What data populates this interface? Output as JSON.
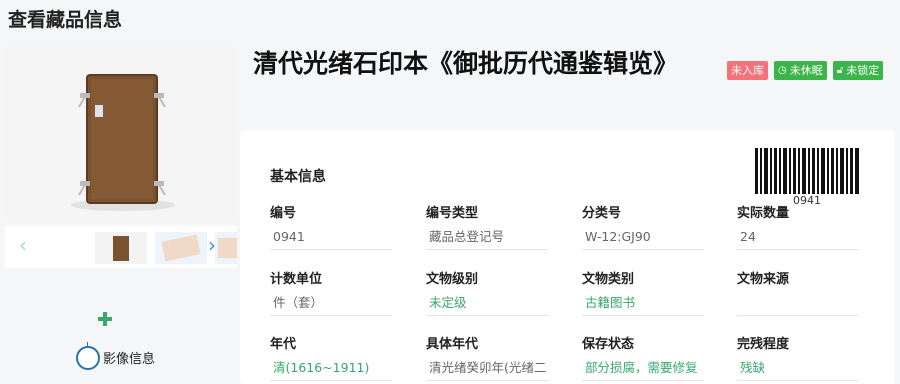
{
  "page_title": "查看藏品信息",
  "item": {
    "title": "清代光绪石印本《御批历代通鉴辑览》",
    "badges": [
      {
        "label": "未入库",
        "color": "#f2737c",
        "icon": ""
      },
      {
        "label": "未休眠",
        "color": "#3bb54a",
        "icon": "clock-icon"
      },
      {
        "label": "未锁定",
        "color": "#3bb54a",
        "icon": "lock-icon"
      }
    ]
  },
  "media": {
    "section_label": "影像信息"
  },
  "barcode": {
    "number": "0941"
  },
  "basic_info": {
    "section_title": "基本信息",
    "fields": [
      {
        "label": "编号",
        "value": "0941"
      },
      {
        "label": "编号类型",
        "value": "藏品总登记号"
      },
      {
        "label": "分类号",
        "value": "W-12:GJ90"
      },
      {
        "label": "实际数量",
        "value": "24"
      },
      {
        "label": "计数单位",
        "value": "件（套）"
      },
      {
        "label": "文物级别",
        "value": "未定级"
      },
      {
        "label": "文物类别",
        "value": "古籍图书"
      },
      {
        "label": "文物来源",
        "value": ""
      },
      {
        "label": "年代",
        "value": "清(1616~1911)"
      },
      {
        "label": "具体年代",
        "value": "清光绪癸卯年(光绪二"
      },
      {
        "label": "保存状态",
        "value": "部分损腐，需要修复"
      },
      {
        "label": "完残程度",
        "value": "残缺"
      }
    ]
  }
}
